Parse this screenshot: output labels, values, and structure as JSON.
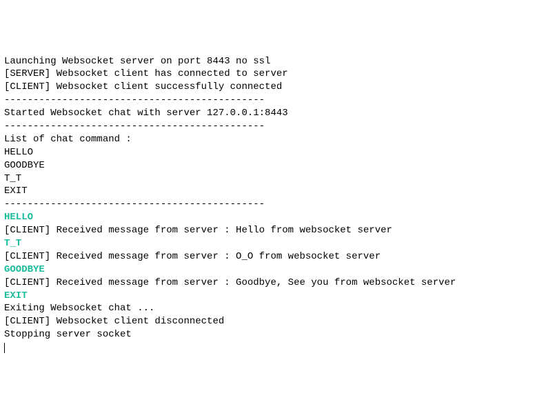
{
  "terminal": {
    "lines": [
      {
        "text": "Launching Websocket server on port 8443 no ssl",
        "cls": ""
      },
      {
        "text": "[SERVER] Websocket client has connected to server",
        "cls": ""
      },
      {
        "text": "[CLIENT] Websocket client successfully connected",
        "cls": ""
      },
      {
        "text": "---------------------------------------------",
        "cls": ""
      },
      {
        "text": "Started Websocket chat with server 127.0.0.1:8443",
        "cls": ""
      },
      {
        "text": "---------------------------------------------",
        "cls": ""
      },
      {
        "text": "List of chat command :",
        "cls": ""
      },
      {
        "text": "HELLO",
        "cls": ""
      },
      {
        "text": "GOODBYE",
        "cls": ""
      },
      {
        "text": "T_T",
        "cls": ""
      },
      {
        "text": "EXIT",
        "cls": ""
      },
      {
        "text": "---------------------------------------------",
        "cls": ""
      },
      {
        "text": "HELLO",
        "cls": "green"
      },
      {
        "text": "[CLIENT] Received message from server : Hello from websocket server",
        "cls": ""
      },
      {
        "text": "T_T",
        "cls": "green"
      },
      {
        "text": "[CLIENT] Received message from server : O_O from websocket server",
        "cls": ""
      },
      {
        "text": "GOODBYE",
        "cls": "green"
      },
      {
        "text": "[CLIENT] Received message from server : Goodbye, See you from websocket server",
        "cls": ""
      },
      {
        "text": "EXIT",
        "cls": "green"
      },
      {
        "text": "Exiting Websocket chat ...",
        "cls": ""
      },
      {
        "text": "[CLIENT] Websocket client disconnected",
        "cls": ""
      },
      {
        "text": "Stopping server socket",
        "cls": ""
      }
    ]
  }
}
